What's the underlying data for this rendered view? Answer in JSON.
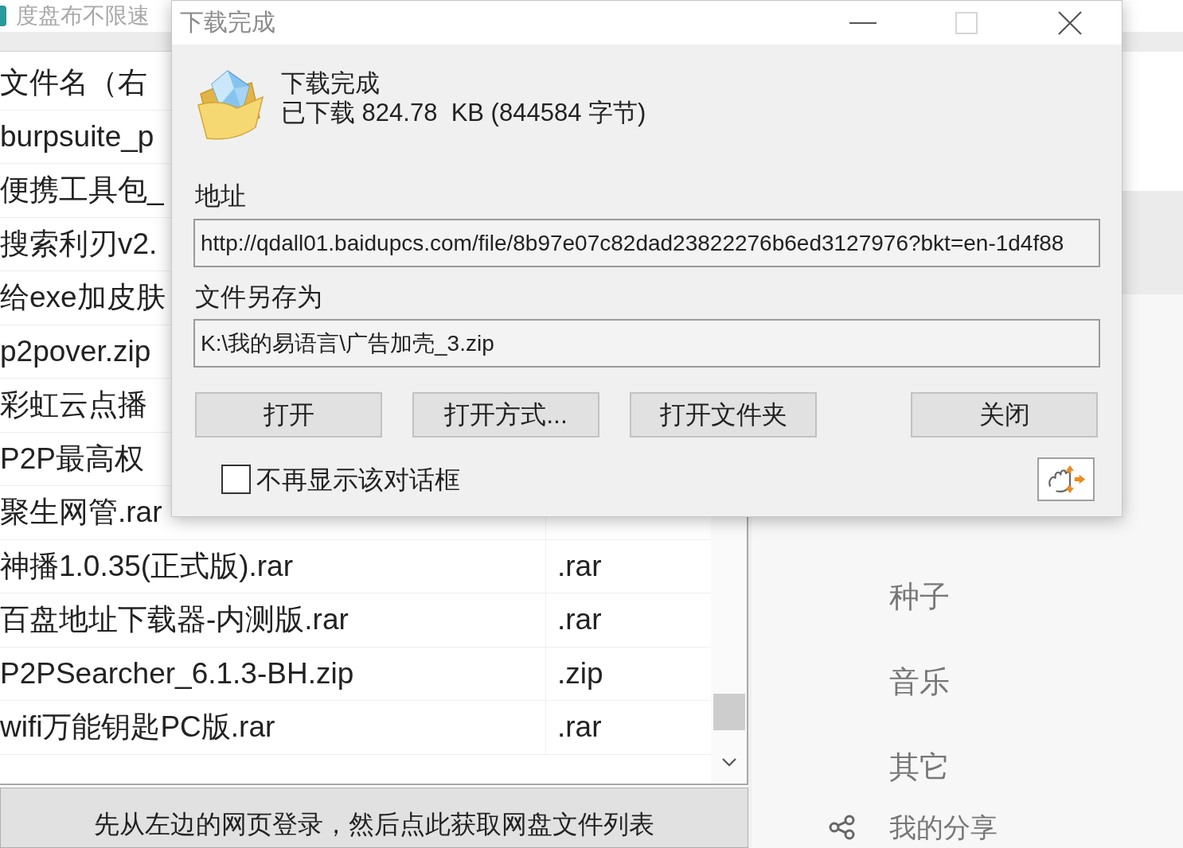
{
  "app": {
    "title": "度盘布不限速",
    "file_list": {
      "columns": [
        "文件名（右"
      ],
      "rows": [
        {
          "name": "burpsuite_p"
        },
        {
          "name": "便携工具包_"
        },
        {
          "name": "搜索利刃v2."
        },
        {
          "name": "给exe加皮肤"
        },
        {
          "name": "p2pover.zip"
        },
        {
          "name": "彩虹云点播"
        },
        {
          "name": "P2P最高权"
        },
        {
          "name": "聚生网管.rar"
        },
        {
          "name": "神播1.0.35(正式版).rar",
          "type": ".rar"
        },
        {
          "name": "百盘地址下载器-内测版.rar",
          "type": ".rar"
        },
        {
          "name": "P2PSearcher_6.1.3-BH.zip",
          "type": ".zip"
        },
        {
          "name": "wifi万能钥匙PC版.rar",
          "type": ".rar"
        }
      ]
    },
    "fetch_button": "先从左边的网页登录，然后点此获取网盘文件列表",
    "categories": [
      "种子",
      "音乐",
      "其它"
    ],
    "share_link": "我的分享"
  },
  "dialog": {
    "title": "下载完成",
    "window_controls": [
      {
        "kind": "minimize",
        "disabled": false
      },
      {
        "kind": "maximize",
        "disabled": true
      },
      {
        "kind": "close",
        "disabled": false
      }
    ],
    "heading": "下载完成",
    "size_info": "已下载 824.78  KB (844584 字节)",
    "address_label": "地址",
    "address": "http://qdall01.baidupcs.com/file/8b97e07c82dad23822276b6ed3127976?bkt=en-1d4f88",
    "save_as_label": "文件另存为",
    "save_path": "K:\\我的易语言\\广告加壳_3.zip",
    "buttons": [
      "打开",
      "打开方式...",
      "打开文件夹",
      "关闭"
    ],
    "dont_show_again": {
      "label": "不再显示该对话框",
      "checked": false
    }
  }
}
